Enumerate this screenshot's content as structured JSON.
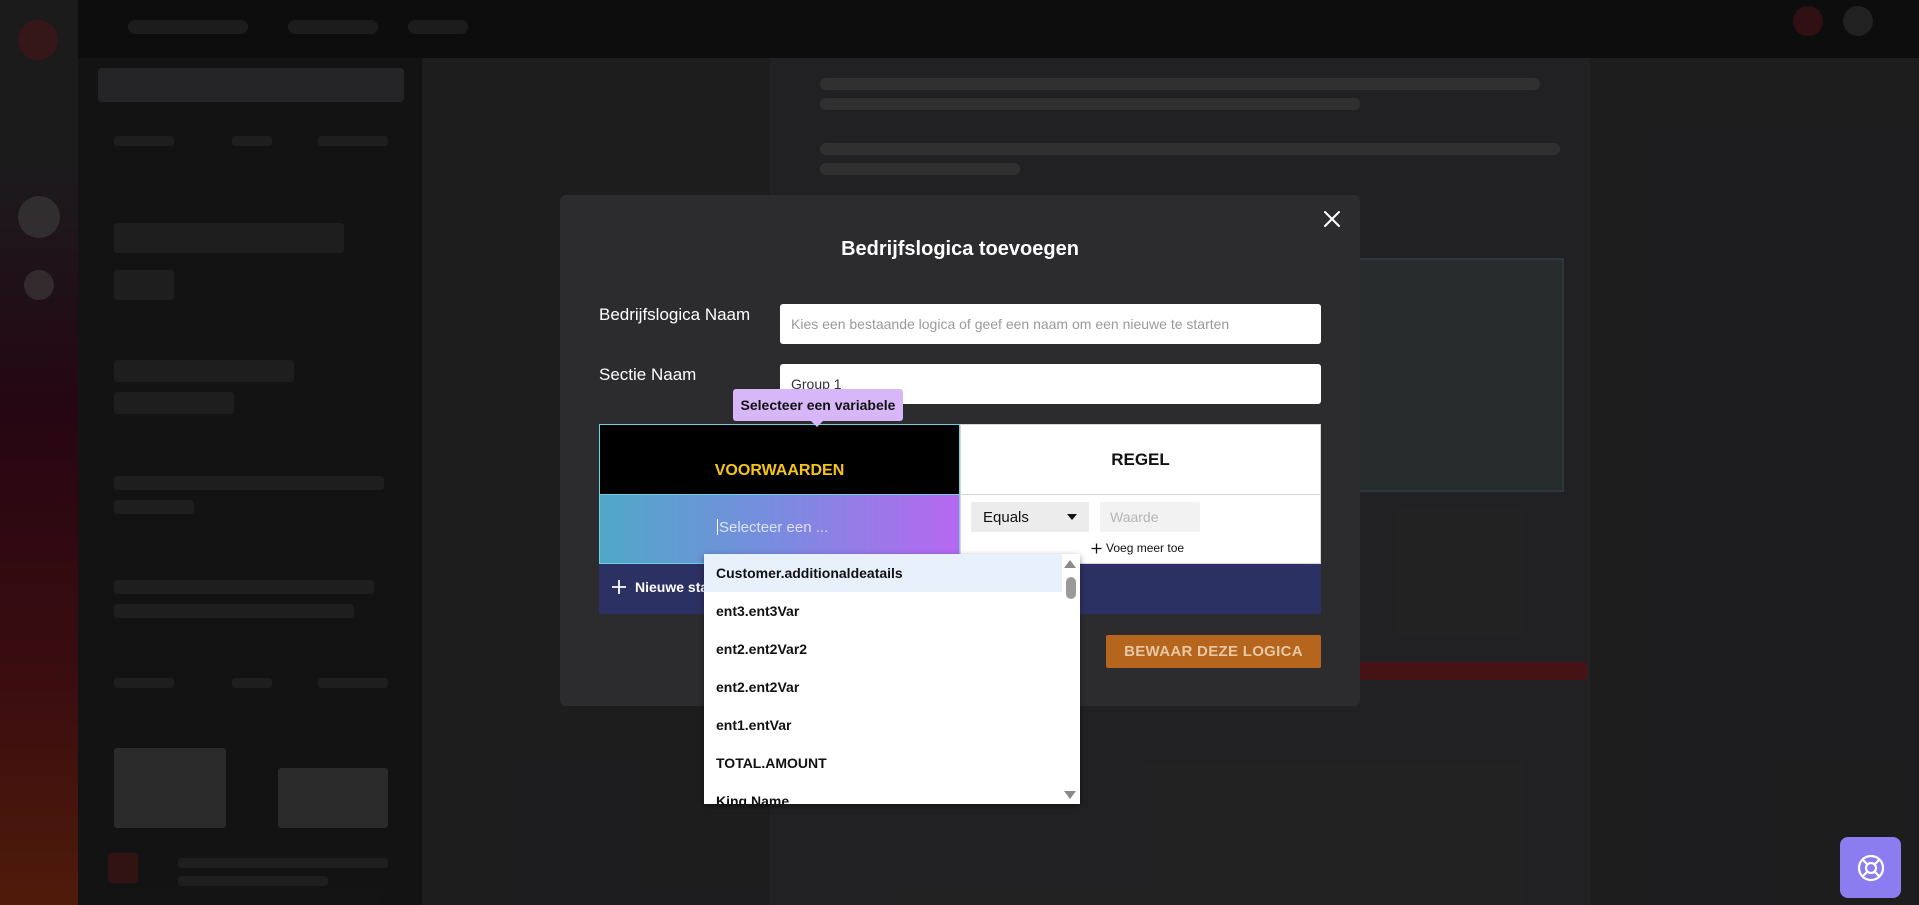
{
  "modal": {
    "title": "Bedrijfslogica toevoegen",
    "name_label": "Bedrijfslogica Naam",
    "name_placeholder": "Kies een bestaande logica of geef een naam om een nieuwe te starten",
    "section_label": "Sectie Naam",
    "section_value": "Group 1",
    "tabs": {
      "conditions": "VOORWAARDEN",
      "rule": "REGEL"
    },
    "tooltip": "Selecteer een variabele",
    "variable_select_placeholder": "Selecteer een ...",
    "operator": "Equals",
    "value_placeholder": "Waarde",
    "add_more": "Voeg meer toe",
    "new_button": "Nieuwe sta",
    "save_button": "BEWAAR DEZE LOGICA"
  },
  "dropdown": {
    "items": [
      "Customer.additionaldeatails",
      "ent3.ent3Var",
      "ent2.ent2Var2",
      "ent2.ent2Var",
      "ent1.entVar",
      "TOTAL.AMOUNT",
      "King.Name"
    ],
    "active_index": 0
  },
  "colors": {
    "accent_yellow": "#f5c518",
    "save_orange": "#b5651d",
    "new_bar": "#2c3163",
    "help_purple": "#8b7cf0"
  }
}
